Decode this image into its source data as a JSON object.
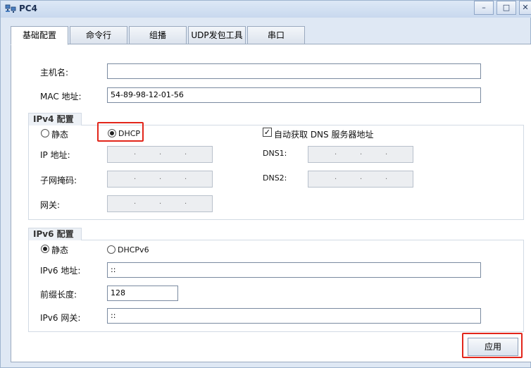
{
  "window": {
    "title": "PC4",
    "minimize": "–",
    "maximize": "□",
    "close": "✕"
  },
  "tabs": [
    {
      "label": "基础配置",
      "active": true
    },
    {
      "label": "命令行"
    },
    {
      "label": "组播"
    },
    {
      "label": "UDP发包工具"
    },
    {
      "label": "串口"
    }
  ],
  "host": {
    "hostname_label": "主机名:",
    "hostname_value": "",
    "mac_label": "MAC 地址:",
    "mac_value": "54-89-98-12-01-56"
  },
  "ipv4": {
    "title": "IPv4 配置",
    "static_label": "静态",
    "dhcp_label": "DHCP",
    "dhcp_selected": true,
    "auto_dns_label": "自动获取 DNS 服务器地址",
    "auto_dns_checked": true,
    "ip_label": "IP 地址:",
    "mask_label": "子网掩码:",
    "gateway_label": "网关:",
    "dns1_label": "DNS1:",
    "dns2_label": "DNS2:",
    "dot": "."
  },
  "ipv6": {
    "title": "IPv6 配置",
    "static_label": "静态",
    "static_selected": true,
    "dhcpv6_label": "DHCPv6",
    "address_label": "IPv6 地址:",
    "address_value": "::",
    "prefix_label": "前缀长度:",
    "prefix_value": "128",
    "gateway_label": "IPv6 网关:",
    "gateway_value": "::"
  },
  "apply_label": "应用",
  "colors": {
    "highlight": "#e2261b"
  }
}
